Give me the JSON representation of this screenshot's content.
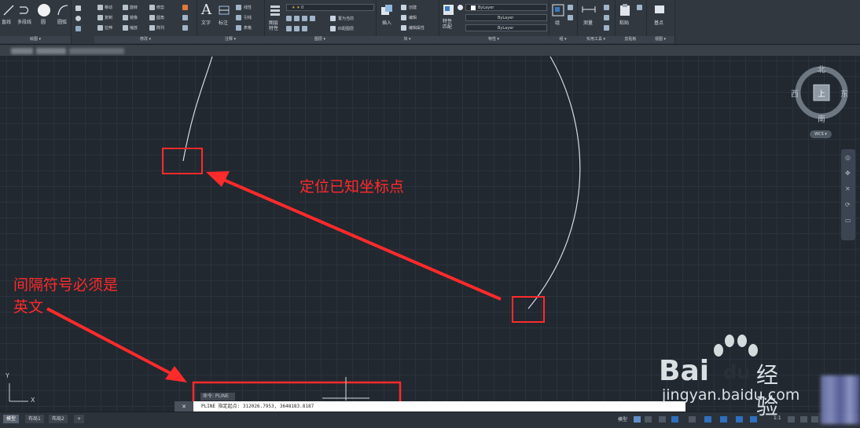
{
  "ribbon": {
    "draw": {
      "line": "直线",
      "polyline": "多段线",
      "circle": "圆",
      "arc": "圆弧",
      "title": "绘图 ▾"
    },
    "modify": {
      "move": "移动",
      "rotate": "旋转",
      "trim": "修剪",
      "copy": "复制",
      "mirror": "镜像",
      "fillet": "圆角",
      "stretch": "拉伸",
      "scale": "缩放",
      "array": "阵列",
      "title": "修改 ▾"
    },
    "annotation": {
      "text": "文字",
      "dim": "标注",
      "linear": "线性",
      "leader": "引线",
      "table": "表格",
      "title": "注释 ▾"
    },
    "layers": {
      "props": "图层\n特性",
      "layer_value": "0",
      "make_current": "置为当前",
      "match": "匹配图层",
      "title": "图层 ▾"
    },
    "block": {
      "insert": "插入",
      "create": "创建",
      "edit": "编辑",
      "edit_attr": "编辑属性",
      "title": "块 ▾"
    },
    "properties": {
      "match": "特性\n匹配",
      "bylayer1": "ByLayer",
      "bylayer2": "ByLayer",
      "bylayer3": "ByLayer",
      "title": "特性 ▾"
    },
    "groups": {
      "group": "组",
      "title": "组 ▾"
    },
    "utilities": {
      "measure": "测量",
      "title": "实用工具 ▾"
    },
    "clipboard": {
      "paste": "粘贴",
      "title": "剪贴板"
    },
    "view": {
      "base": "基点",
      "title": "视图 ▾"
    }
  },
  "viewcube": {
    "north": "北",
    "south": "南",
    "east": "东",
    "west": "西",
    "top": "上",
    "wcs": "WCS ▾"
  },
  "annotations": {
    "locate": "定位已知坐标点",
    "separator_line1": "间隔符号必须是",
    "separator_line2": "英文"
  },
  "command": {
    "history": "命令: PLINE",
    "prompt": "PLINE 指定起点: ",
    "input": "312026.7953, 3648183.8187",
    "close": "✕"
  },
  "layout_tabs": [
    "模型",
    "布局1",
    "布局2",
    "+"
  ],
  "status": {
    "model": "模型",
    "scale": "1:1"
  },
  "ucs": {
    "x": "X",
    "y": "Y"
  },
  "watermark": {
    "brand_bai": "Bai",
    "brand_du": "du",
    "suffix": "经验",
    "url": "jingyan.baidu.com"
  },
  "colors": {
    "annotation_red": "#ff2a2a",
    "background": "#212830",
    "ribbon": "#323840"
  }
}
